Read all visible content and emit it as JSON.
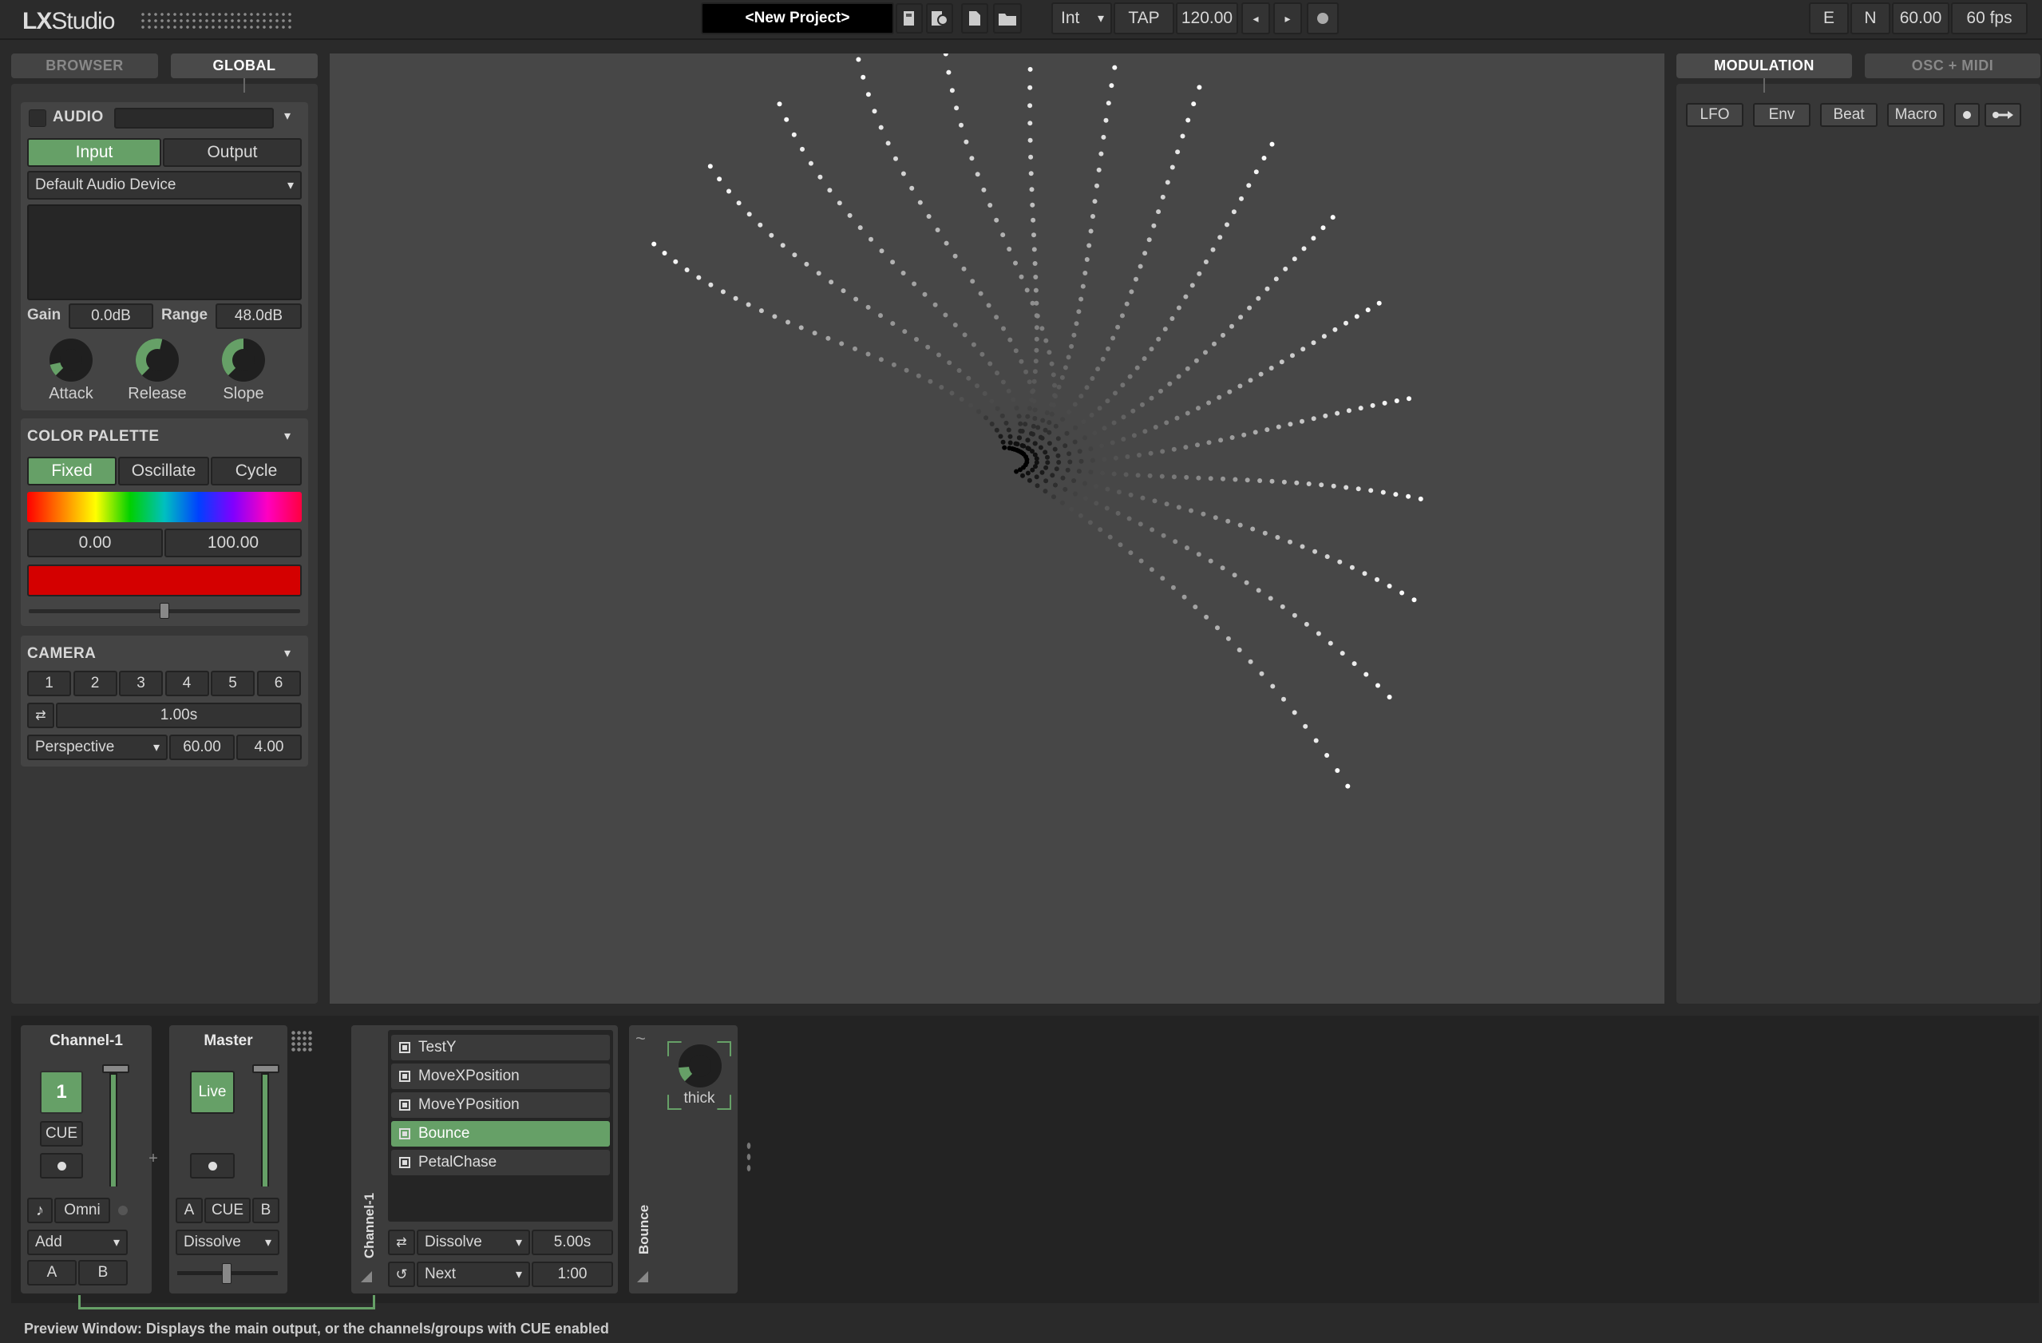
{
  "app": {
    "logo": "LX",
    "logo_name": "Studio"
  },
  "toolbar": {
    "project": "<New Project>",
    "clock": "Int",
    "tap": "TAP",
    "bpm": "120.00",
    "e": "E",
    "n": "N",
    "fps_value": "60.00",
    "fps_label": "60 fps"
  },
  "left_tabs": {
    "browser": "BROWSER",
    "global": "GLOBAL"
  },
  "audio": {
    "title": "AUDIO",
    "input": "Input",
    "output": "Output",
    "device": "Default Audio Device",
    "gain_label": "Gain",
    "gain": "0.0dB",
    "range_label": "Range",
    "range": "48.0dB",
    "knobs": [
      {
        "label": "Attack",
        "value": 0.12
      },
      {
        "label": "Release",
        "value": 0.55
      },
      {
        "label": "Slope",
        "value": 0.5
      }
    ]
  },
  "palette": {
    "title": "COLOR PALETTE",
    "modes": [
      "Fixed",
      "Oscillate",
      "Cycle"
    ],
    "min": "0.00",
    "max": "100.00",
    "swatch_color": "#d40000",
    "slider": 0.5
  },
  "camera": {
    "title": "CAMERA",
    "presets": [
      "1",
      "2",
      "3",
      "4",
      "5",
      "6"
    ],
    "duration": "1.00s",
    "projection": "Perspective",
    "fov": "60.00",
    "depth": "4.00"
  },
  "right_tabs": {
    "modulation": "MODULATION",
    "osc": "OSC + MIDI"
  },
  "modulators": [
    "LFO",
    "Env",
    "Beat",
    "Macro"
  ],
  "mixer": {
    "channel_name": "Channel-1",
    "channel_number": "1",
    "cue": "CUE",
    "master_name": "Master",
    "live": "Live",
    "plus": "+",
    "omni": "Omni",
    "blend": "Add",
    "a": "A",
    "b": "B",
    "master_cue": "CUE",
    "transition": "Dissolve"
  },
  "patterns": {
    "items": [
      "TestY",
      "MoveXPosition",
      "MoveYPosition",
      "Bounce",
      "PetalChase"
    ],
    "active_index": 3,
    "strip_label": "Channel-1",
    "transition": "Dissolve",
    "transition_time": "5.00s",
    "auto": "Next",
    "auto_time": "1:00"
  },
  "device": {
    "label": "Bounce",
    "knob_label": "thick",
    "knob_value": 0.15
  },
  "status": "Preview Window: Displays the main output, or the channels/groups with CUE enabled"
}
